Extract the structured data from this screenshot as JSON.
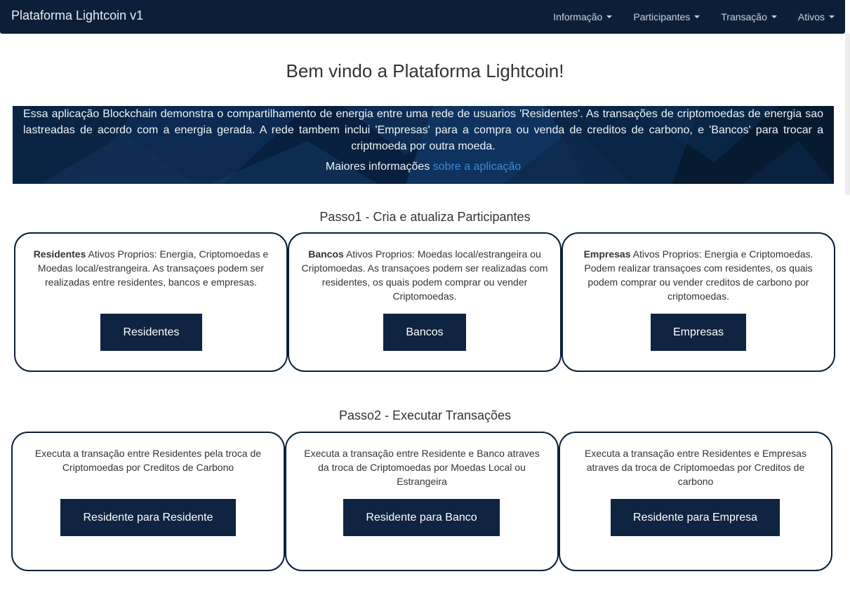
{
  "navbar": {
    "brand": "Plataforma Lightcoin v1",
    "menu": [
      {
        "label": "Informação"
      },
      {
        "label": "Participantes"
      },
      {
        "label": "Transação"
      },
      {
        "label": "Ativos"
      }
    ]
  },
  "main": {
    "title": "Bem vindo a Plataforma Lightcoin!",
    "banner": {
      "text": "Essa aplicação Blockchain demonstra o compartilhamento de energia entre uma rede de usuarios 'Residentes'. As transações de criptomoedas de energia sao lastreadas de acordo com a energia gerada. A rede tambem inclui 'Empresas' para a compra ou venda de creditos de carbono, e 'Bancos' para trocar a criptmoeda por outra moeda.",
      "more_prefix": "Maiores informações",
      "more_link": "sobre a aplicação"
    }
  },
  "step1": {
    "title": "Passo1 - Cria e atualiza Participantes",
    "cards": [
      {
        "bold": "Residentes",
        "text": "Ativos Proprios: Energia, Criptomoedas e Moedas local/estrangeira. As transaçoes podem ser realizadas entre residentes, bancos e empresas.",
        "button": "Residentes"
      },
      {
        "bold": "Bancos",
        "text": "Ativos Proprios: Moedas local/estrangeira ou Criptomoedas. As transaçoes podem ser realizadas com residentes, os quais podem comprar ou vender Criptomoedas.",
        "button": "Bancos"
      },
      {
        "bold": "Empresas",
        "text": "Ativos Proprios: Energia e Criptomoedas. Podem realizar transaçoes com residentes, os quais podem comprar ou vender creditos de carbono por criptomoedas.",
        "button": "Empresas"
      }
    ]
  },
  "step2": {
    "title": "Passo2 - Executar Transações",
    "cards": [
      {
        "text": "Executa a transação entre Residentes pela troca de Criptomoedas por Creditos de Carbono",
        "button": "Residente para Residente"
      },
      {
        "text": "Executa a transação entre Residente e Banco atraves da troca de Criptomoedas por Moedas Local ou Estrangeira",
        "button": "Residente para Banco"
      },
      {
        "text": "Executa a transação entre Residentes e Empresas atraves da troca de Criptomoedas por Creditos de carbono",
        "button": "Residente para Empresa"
      }
    ]
  },
  "colors": {
    "navbar": "#0b2038",
    "button": "#0e2440",
    "link": "#3a8bd4",
    "card_border": "#0b2038"
  }
}
